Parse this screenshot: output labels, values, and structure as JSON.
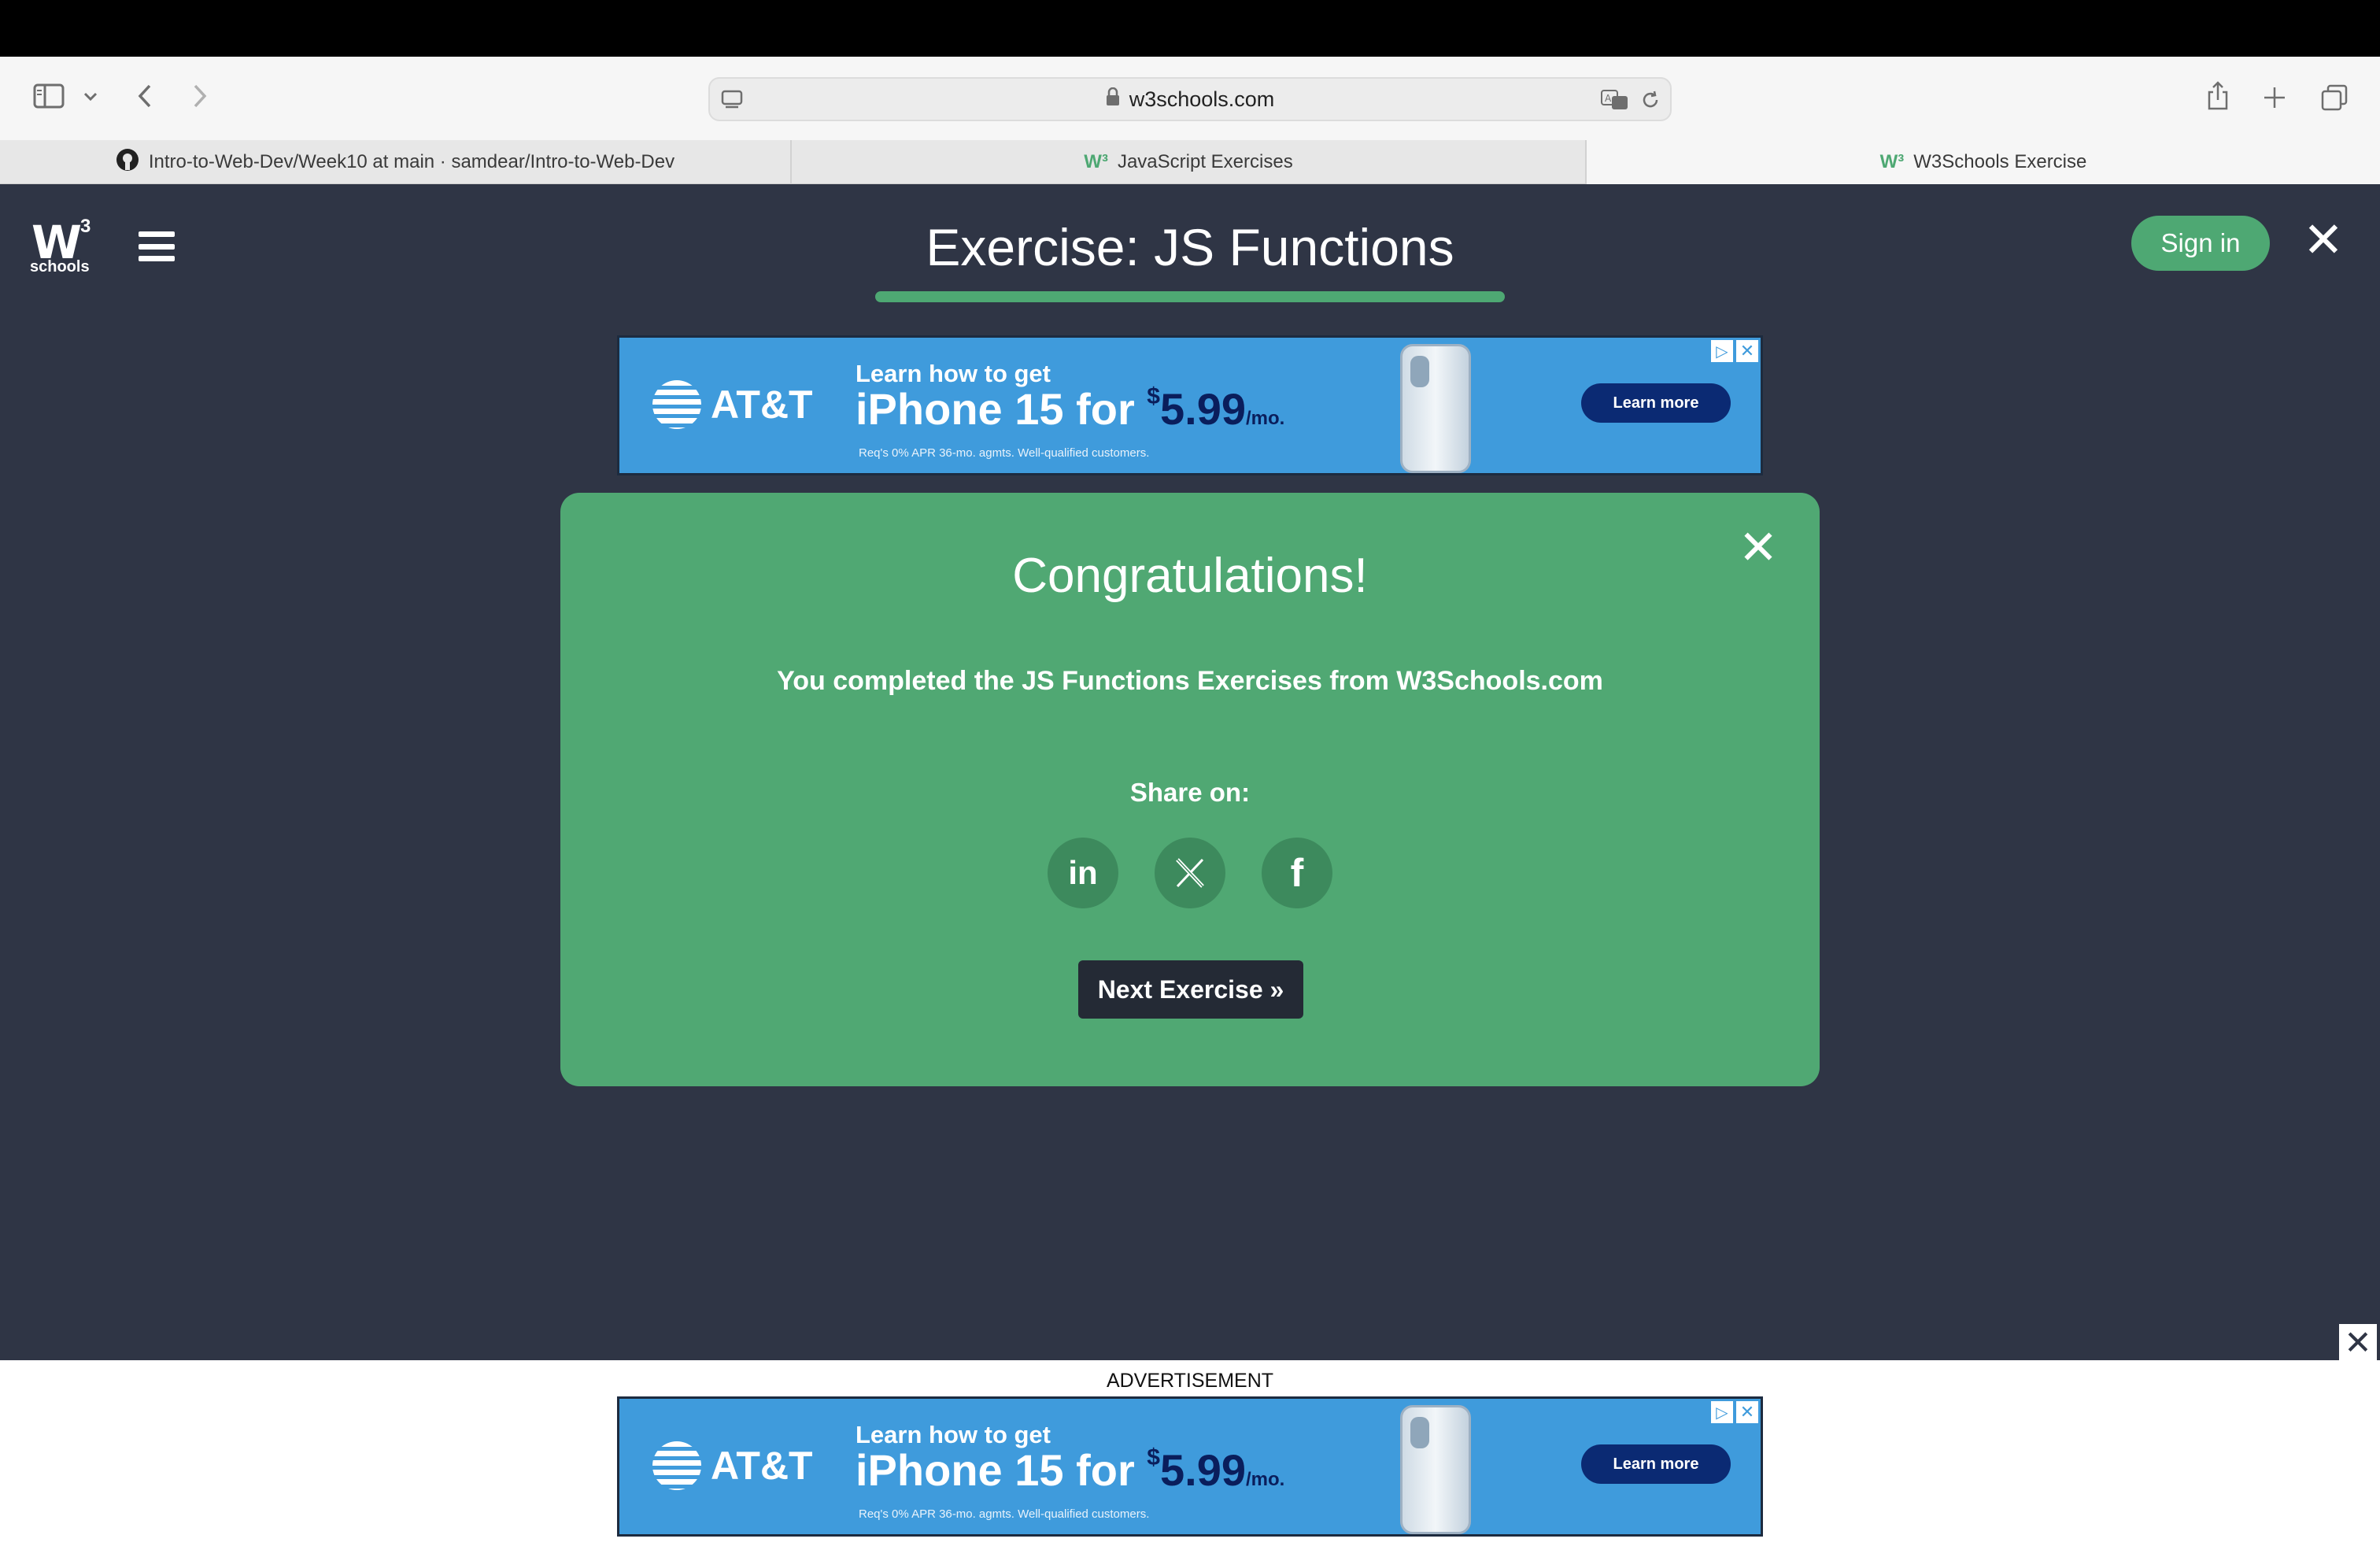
{
  "browser": {
    "url": "w3schools.com",
    "tabs": [
      {
        "label": "Intro-to-Web-Dev/Week10 at main · samdear/Intro-to-Web-Dev"
      },
      {
        "label": "JavaScript Exercises"
      },
      {
        "label": "W3Schools Exercise"
      }
    ],
    "tab_close": "×"
  },
  "header": {
    "logo_mark": "W",
    "logo_superscript": "3",
    "logo_sub": "schools",
    "title": "Exercise: JS Functions",
    "sign_in": "Sign in",
    "close": "✕"
  },
  "ad": {
    "brand": "AT&T",
    "line1": "Learn how to get",
    "line2_product": "iPhone 15 for ",
    "price_symbol": "$",
    "price": "5.99",
    "price_unit": "/mo.",
    "fine_print": "Req's 0% APR 36-mo. agmts. Well-qualified customers.",
    "cta": "Learn more",
    "choices_icon": "▷",
    "close_icon": "✕"
  },
  "modal": {
    "heading": "Congratulations!",
    "message": "You completed the JS Functions Exercises from W3Schools.com",
    "share_label": "Share on:",
    "share": [
      {
        "name": "linkedin",
        "glyph": "in"
      },
      {
        "name": "x",
        "glyph": "𝕏"
      },
      {
        "name": "facebook",
        "glyph": "f"
      }
    ],
    "next": "Next Exercise »",
    "close": "✕"
  },
  "bottom": {
    "label": "ADVERTISEMENT",
    "close": "✕"
  },
  "colors": {
    "page_bg": "#2f3545",
    "accent_green": "#4ea873",
    "modal_bg": "#50a873",
    "ad_blue": "#3f9bdc"
  }
}
